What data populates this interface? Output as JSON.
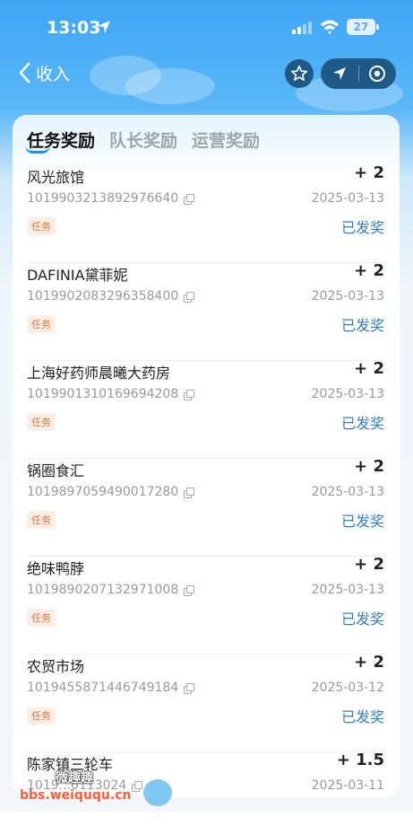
{
  "status_bar": {
    "time": "13:03",
    "battery": "27"
  },
  "header": {
    "back_label": "收入"
  },
  "tabs": [
    {
      "label": "任务奖励",
      "active": true
    },
    {
      "label": "队长奖励",
      "active": false
    },
    {
      "label": "运营奖励",
      "active": false
    }
  ],
  "records": [
    {
      "name": "风光旅馆",
      "amount": "+ 2",
      "order_id": "1019903213892976640",
      "date": "2025-03-13",
      "tag": "任务",
      "status": "已发奖"
    },
    {
      "name": "DAFINIA黛菲妮",
      "amount": "+ 2",
      "order_id": "1019902083296358400",
      "date": "2025-03-13",
      "tag": "任务",
      "status": "已发奖"
    },
    {
      "name": "上海好药师晨曦大药房",
      "amount": "+ 2",
      "order_id": "1019901310169694208",
      "date": "2025-03-13",
      "tag": "任务",
      "status": "已发奖"
    },
    {
      "name": "锅圈食汇",
      "amount": "+ 2",
      "order_id": "1019897059490017280",
      "date": "2025-03-13",
      "tag": "任务",
      "status": "已发奖"
    },
    {
      "name": "绝味鸭脖",
      "amount": "+ 2",
      "order_id": "1019890207132971008",
      "date": "2025-03-13",
      "tag": "任务",
      "status": "已发奖"
    },
    {
      "name": "农贸市场",
      "amount": "+ 2",
      "order_id": "1019455871446749184",
      "date": "2025-03-12",
      "tag": "任务",
      "status": "已发奖"
    },
    {
      "name": "陈家镇三轮车",
      "amount": "+ 1.5",
      "order_id": "1019...0113024",
      "date": "2025-03-11",
      "tag": "",
      "status": ""
    }
  ],
  "watermark": {
    "title": "微趣趣",
    "url": "bbs.weiququ.cn"
  },
  "colors": {
    "accent": "#1e8ee8",
    "status_blue": "#2f7fc2",
    "tag_orange": "#e0733c",
    "header_dark": "#1f5a86"
  }
}
